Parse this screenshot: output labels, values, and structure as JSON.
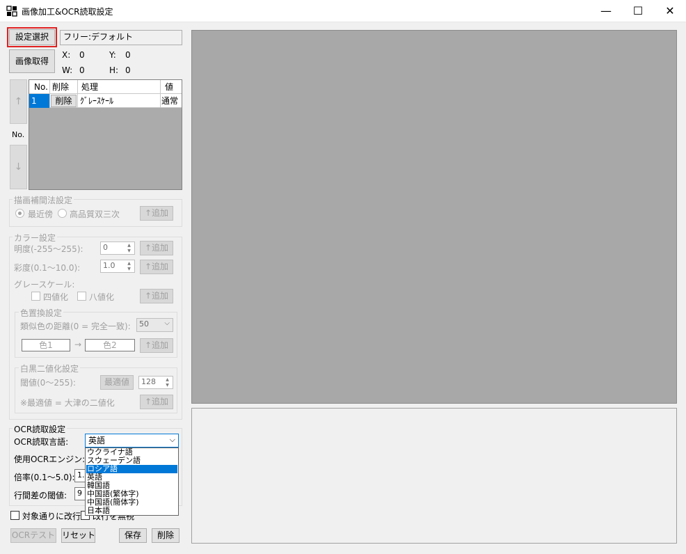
{
  "window": {
    "title": "画像加工&OCR読取設定",
    "minimize": "—",
    "maximize": "☐",
    "close": "✕"
  },
  "top": {
    "settings_select": "設定選択",
    "preset_name": "フリー:デフォルト",
    "acquire_image": "画像取得",
    "x_label": "X:",
    "x_value": "0",
    "y_label": "Y:",
    "y_value": "0",
    "w_label": "W:",
    "w_value": "0",
    "h_label": "H:",
    "h_value": "0"
  },
  "steps": {
    "up_arrow": "↑",
    "no_label": "No.",
    "down_arrow": "↓",
    "headers": {
      "no": "No.",
      "delete": "削除",
      "process": "処理",
      "value": "値"
    },
    "rows": [
      {
        "no": "1",
        "delete": "削除",
        "process": "ｸﾞﾚｰｽｹｰﾙ",
        "value": "通常"
      }
    ]
  },
  "interp": {
    "title": "描画補間法設定",
    "nearest": "最近傍",
    "bicubic": "高品質双三次",
    "add": "↑追加"
  },
  "color": {
    "title": "カラー設定",
    "brightness_label": "明度(-255～255):",
    "brightness_value": "0",
    "saturation_label": "彩度(0.1～10.0):",
    "saturation_value": "1.0",
    "grayscale_label": "グレースケール:",
    "four_level": "四値化",
    "eight_level": "八値化",
    "add": "↑追加"
  },
  "replace": {
    "title": "色置換設定",
    "distance_label": "類似色の距離(0 = 完全一致):",
    "distance_value": "50",
    "color1": "色1",
    "arrow": "→",
    "color2": "色2",
    "add": "↑追加"
  },
  "binarize": {
    "title": "白黒二値化設定",
    "threshold_label": "閾値(0～255):",
    "optimal": "最適値",
    "threshold_value": "128",
    "note": "※最適値 = 大津の二値化",
    "add": "↑追加"
  },
  "ocr": {
    "title": "OCR読取設定",
    "language_label": "OCR読取言語:",
    "language_value": "英語",
    "engine_label": "使用OCRエンジン:",
    "scale_label": "倍率(0.1～5.0):",
    "scale_value": "1.0",
    "line_gap_label": "行間差の閾値:",
    "line_gap_value": "9",
    "newline_check": "対象通りに改行",
    "ignore_check": "改行を無視",
    "language_options": [
      "ウクライナ語",
      "スウェーデン語",
      "ロシア語",
      "英語",
      "韓国語",
      "中国語(繁体字)",
      "中国語(簡体字)",
      "日本語"
    ],
    "highlighted_option": "ロシア語"
  },
  "bottom": {
    "ocr_test": "OCRテスト",
    "reset": "リセット",
    "save": "保存",
    "delete": "削除"
  }
}
